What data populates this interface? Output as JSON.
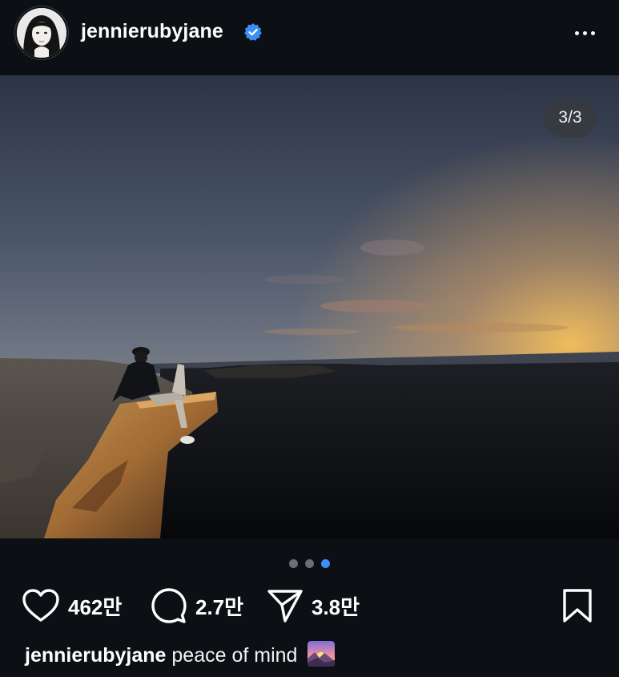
{
  "post": {
    "username": "jennierubyjane",
    "verified": true,
    "media_counter": "3/3",
    "carousel": {
      "total": 3,
      "active_index": 2
    },
    "likes": "462만",
    "comments": "2.7만",
    "shares": "3.8만",
    "caption_user": "jennierubyjane",
    "caption_text": "peace of mind",
    "caption_emoji": "sunrise-over-mountains-emoji"
  },
  "icons": {
    "more": "more-options-icon",
    "like": "heart-icon",
    "comment": "comment-icon",
    "share": "send-icon",
    "save": "bookmark-icon",
    "verified": "verified-badge-icon"
  },
  "colors": {
    "background": "#0c0f14",
    "verified_blue": "#3d8ef5",
    "active_dot": "#3d8ef5",
    "inactive_dot": "#6b6e73"
  }
}
